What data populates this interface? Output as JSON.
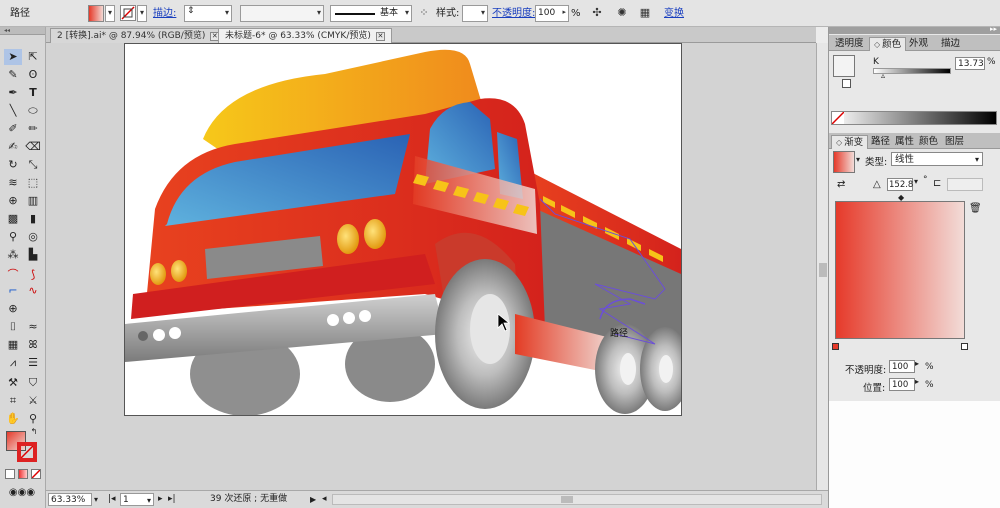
{
  "control_bar": {
    "object_type": "路径",
    "stroke_label": "描边:",
    "stroke_profile": "基本",
    "style_label": "样式:",
    "opacity_label": "不透明度:",
    "opacity_value": "100",
    "opacity_unit": "%",
    "transform_label": "变换"
  },
  "tabs": [
    {
      "label": "2 [转换].ai* @ 87.94% (RGB/预览)"
    },
    {
      "label": "未标题-6* @ 63.33% (CMYK/预览)"
    }
  ],
  "canvas": {
    "cursor_tooltip": "路径"
  },
  "status_bar": {
    "zoom": "63.33%",
    "page": "1",
    "history": "39 次还原 ; 无重做"
  },
  "color_panel": {
    "tabs": [
      "透明度",
      "颜色",
      "外观",
      "描边"
    ],
    "active_tab": "颜色",
    "channel_label": "K",
    "channel_value": "13.73",
    "channel_unit": "%"
  },
  "gradient_panel": {
    "tabs": [
      "渐变",
      "路径",
      "属性",
      "颜色",
      "图层"
    ],
    "active_tab": "渐变",
    "type_label": "类型:",
    "type_value": "线性",
    "angle_value": "152.8",
    "angle_unit": "°",
    "opacity_label": "不透明度:",
    "opacity_value": "100",
    "location_label": "位置:",
    "location_value": "100",
    "percent": "%",
    "gradient_start_color": "#e63a2a",
    "gradient_end_color": "#f2dcd8"
  }
}
